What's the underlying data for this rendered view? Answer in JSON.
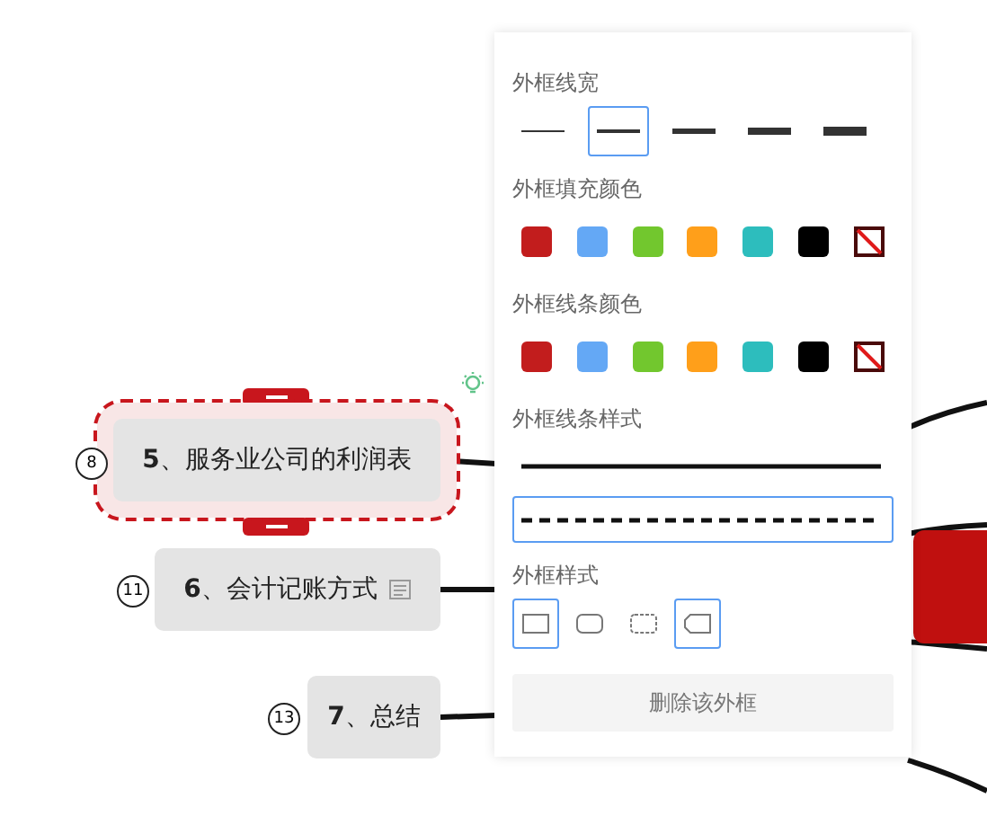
{
  "canvas": {
    "nodes": [
      {
        "number": "8",
        "label": "**5**、服务业公司的利润表",
        "selected": true,
        "note": false
      },
      {
        "number": "11",
        "label": "**6**、会计记账方式",
        "selected": false,
        "note": true
      },
      {
        "number": "13",
        "label": "**7**、总结",
        "selected": false,
        "note": false
      }
    ]
  },
  "panel": {
    "border_width": {
      "title": "外框线宽",
      "options": [
        {
          "selected": false
        },
        {
          "selected": true
        },
        {
          "selected": false
        },
        {
          "selected": false
        },
        {
          "selected": false
        }
      ]
    },
    "fill_color": {
      "title": "外框填充颜色",
      "swatches": [
        {
          "kind": "color",
          "color": "#c21d1d"
        },
        {
          "kind": "color",
          "color": "#64a8f5"
        },
        {
          "kind": "color",
          "color": "#72c72e"
        },
        {
          "kind": "color",
          "color": "#ff9f1a"
        },
        {
          "kind": "color",
          "color": "#2dbdbd"
        },
        {
          "kind": "color",
          "color": "#000000"
        },
        {
          "kind": "none"
        }
      ]
    },
    "line_color": {
      "title": "外框线条颜色",
      "swatches": [
        {
          "kind": "color",
          "color": "#c21d1d"
        },
        {
          "kind": "color",
          "color": "#64a8f5"
        },
        {
          "kind": "color",
          "color": "#72c72e"
        },
        {
          "kind": "color",
          "color": "#ff9f1a"
        },
        {
          "kind": "color",
          "color": "#2dbdbd"
        },
        {
          "kind": "color",
          "color": "#000000"
        },
        {
          "kind": "none"
        }
      ]
    },
    "line_style": {
      "title": "外框线条样式",
      "options": [
        {
          "kind": "solid",
          "selected": false
        },
        {
          "kind": "dashed",
          "selected": true
        }
      ]
    },
    "shape": {
      "title": "外框样式",
      "options": [
        {
          "kind": "rect",
          "selected": true
        },
        {
          "kind": "rounded",
          "selected": false
        },
        {
          "kind": "rough",
          "selected": false
        },
        {
          "kind": "tag",
          "selected": true
        }
      ]
    },
    "delete_button": "删除该外框"
  }
}
